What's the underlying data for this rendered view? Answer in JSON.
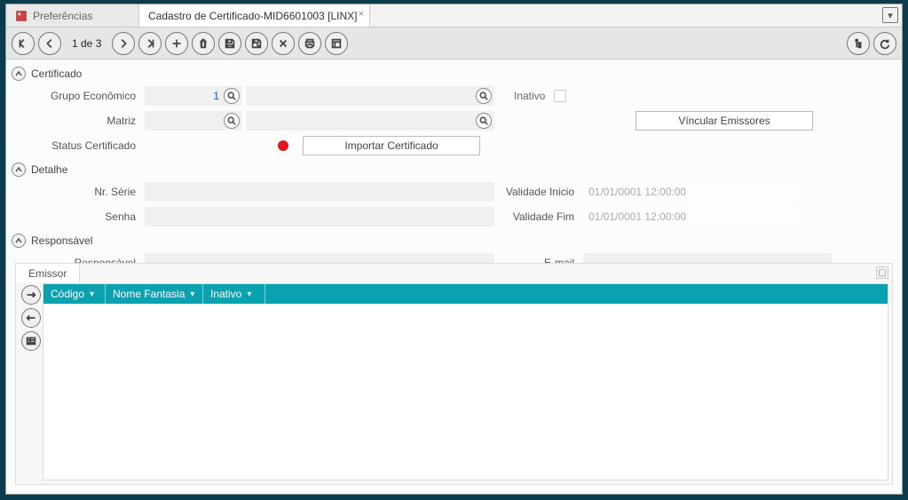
{
  "tabs": {
    "preferencias": {
      "label": "Preferências"
    },
    "cadastro": {
      "label": "Cadastro de Certificado-MID6601003 [LINX]"
    }
  },
  "toolbar": {
    "counter": "1 de 3"
  },
  "section": {
    "certificado": {
      "title": "Certificado"
    },
    "detalhe": {
      "title": "Detalhe"
    },
    "responsavel": {
      "title": "Responsável"
    }
  },
  "labels": {
    "grupo": "Grupo Econômico",
    "matriz": "Matriz",
    "status": "Status Certificado",
    "nrserie": "Nr. Série",
    "senha": "Senha",
    "valini": "Validade Inicio",
    "valfim": "Validade Fim",
    "responsavel": "Responsável",
    "email": "E-mail",
    "inativo": "Inativo"
  },
  "values": {
    "grupo": "1",
    "valini": "01/01/0001 12:00:00",
    "valfim": "01/01/0001 12:00:00"
  },
  "buttons": {
    "importar": "Importar Certificado",
    "vincular": "Víncular Emissores"
  },
  "subgrid": {
    "tab": "Emissor",
    "cols": {
      "codigo": "Código",
      "nome": "Nome Fantasia",
      "inativo": "Inativo"
    }
  }
}
